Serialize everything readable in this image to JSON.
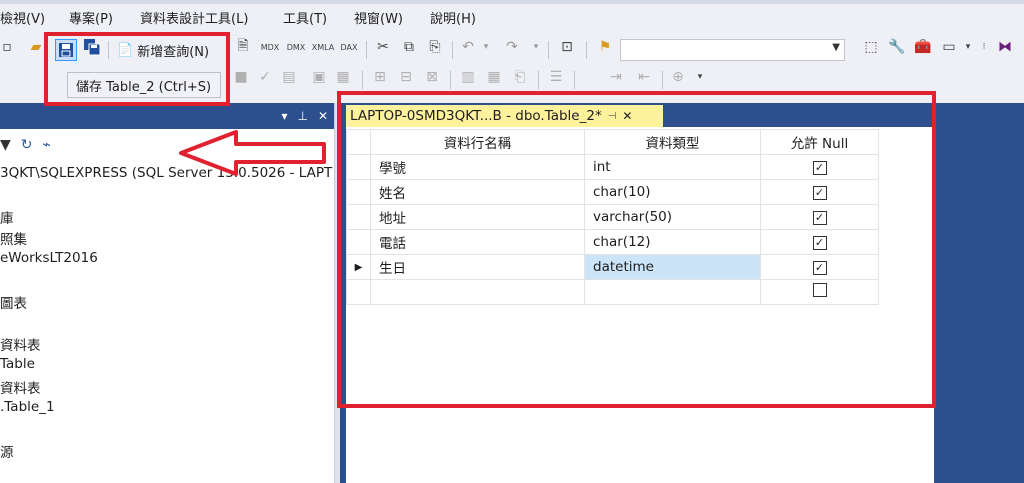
{
  "menu": {
    "items": [
      "檢視(V)",
      "專案(P)",
      "資料表設計工具(L)",
      "工具(T)",
      "視窗(W)",
      "說明(H)"
    ]
  },
  "toolbar": {
    "new_query_label": "新增查詢(N)",
    "save_tooltip": "儲存 Table_2 (Ctrl+S)",
    "combo_value": "",
    "icon_labels": [
      "MDX",
      "DMX",
      "XMLA",
      "DAX"
    ]
  },
  "object_explorer": {
    "pin_glyph": "▾ 📌 ✕",
    "lines": [
      "3QKT\\SQLEXPRESS (SQL Server 13.0.5026 - LAPT",
      "庫",
      "照集",
      "eWorksLT2016",
      "圖表",
      "資料表",
      "Table",
      "資料表",
      ".Table_1",
      "源"
    ]
  },
  "document": {
    "tab_title": "LAPTOP-0SMD3QKT...B - dbo.Table_2*",
    "grid": {
      "headers": [
        "資料行名稱",
        "資料類型",
        "允許 Null"
      ],
      "rows": [
        {
          "name": "學號",
          "type": "int",
          "allow_null": true
        },
        {
          "name": "姓名",
          "type": "char(10)",
          "allow_null": true
        },
        {
          "name": "地址",
          "type": "varchar(50)",
          "allow_null": true
        },
        {
          "name": "電話",
          "type": "char(12)",
          "allow_null": true
        },
        {
          "name": "生日",
          "type": "datetime",
          "allow_null": true
        },
        {
          "name": "",
          "type": "",
          "allow_null": false
        }
      ]
    }
  },
  "colors": {
    "accent_blue": "#2d4f8e",
    "annotation_red": "#e0212f",
    "tab_yellow": "#fff29d",
    "selection": "#cce4f7"
  }
}
